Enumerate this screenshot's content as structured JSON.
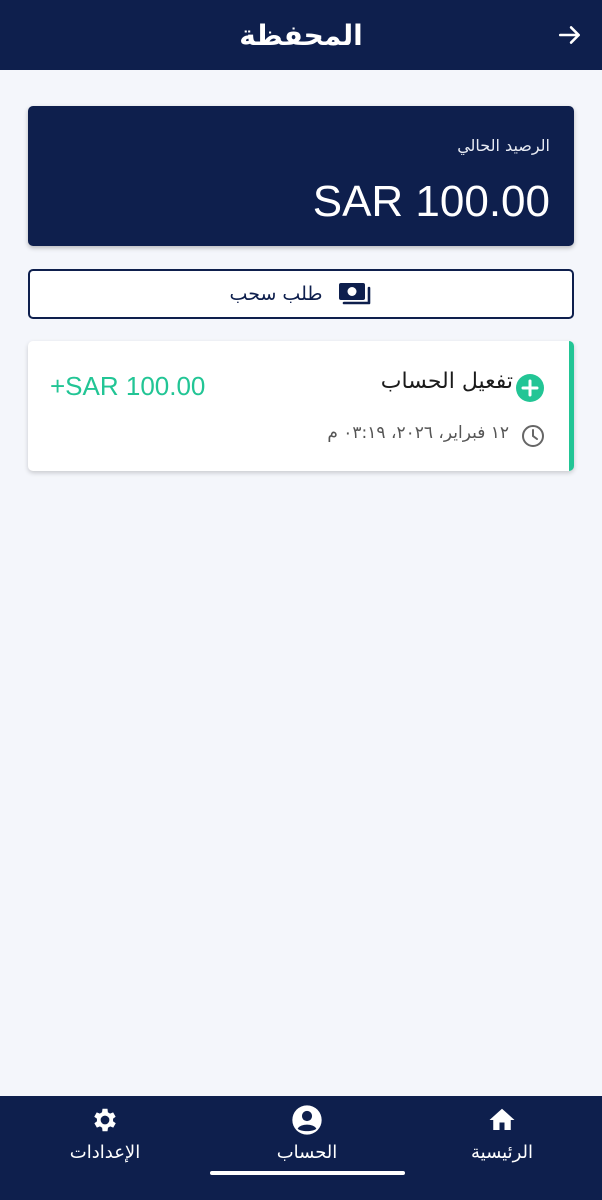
{
  "header": {
    "title": "المحفظة",
    "back_icon": "arrow-right-icon"
  },
  "balance": {
    "label": "الرصيد الحالي",
    "amount": "SAR 100.00"
  },
  "withdraw": {
    "label": "طلب سحب",
    "icon": "cash-icon"
  },
  "transactions": [
    {
      "title": "تفعيل الحساب",
      "amount": "+SAR 100.00",
      "date": "١٢ فبراير، ٢٠٢٦، ٠٣:١٩ م",
      "type_icon": "plus-circle-icon",
      "time_icon": "clock-icon"
    }
  ],
  "nav": {
    "items": [
      {
        "label": "الرئيسية",
        "icon": "home-icon"
      },
      {
        "label": "الحساب",
        "icon": "account-circle-icon",
        "active": true
      },
      {
        "label": "الإعدادات",
        "icon": "gear-icon"
      }
    ]
  },
  "colors": {
    "primary": "#0e1f4d",
    "accent": "#22c595",
    "background": "#f4f6fb"
  }
}
